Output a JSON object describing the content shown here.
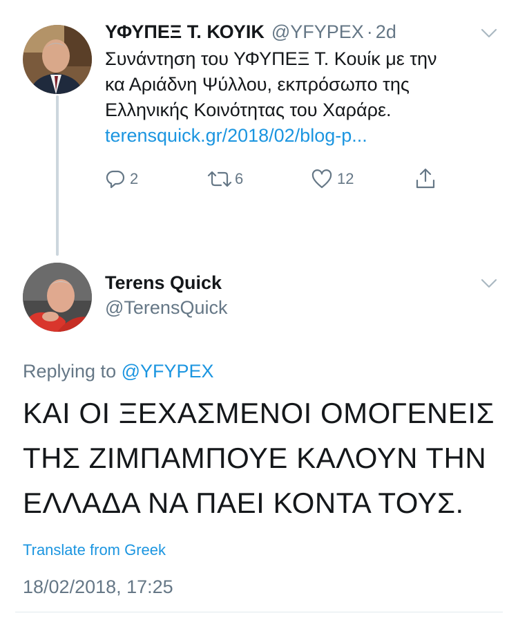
{
  "tweet1": {
    "display_name": "ΥΦΥΠΕΞ Τ. ΚΟΥΙΚ",
    "handle": "@YFYPEX",
    "separator": "·",
    "age": "2d",
    "text_lines": [
      "Συνάντηση του ΥΦΥΠΕΞ Τ. Κουίκ με την",
      "κα Αριάδνη Ψύλλου, εκπρόσωπο της",
      "Ελληνικής Κοινότητας του Χαράρε."
    ],
    "link": "terensquick.gr/2018/02/blog-p...",
    "actions": {
      "replies": "2",
      "retweets": "6",
      "likes": "12"
    }
  },
  "tweet2": {
    "display_name": "Terens Quick",
    "handle": "@TerensQuick",
    "replying_prefix": "Replying to",
    "replying_handle": "@YFYPEX",
    "text_lines": [
      "ΚΑΙ ΟΙ ΞΕΧΑΣΜΕΝΟΙ ΟΜΟΓΕΝΕΙΣ",
      "ΤΗΣ ΖΙΜΠΑΜΠΟΥΕ ΚΑΛΟΥΝ ΤΗΝ",
      "ΕΛΛΑΔΑ ΝΑ ΠΑΕΙ ΚΟΝΤΑ ΤΟΥΣ."
    ],
    "translate_label": "Translate from Greek",
    "timestamp": "18/02/2018, 17:25"
  },
  "colors": {
    "link": "#1b95e0",
    "secondary": "#657786",
    "primary_text": "#14171a",
    "thread_line": "#ccd6dd"
  }
}
